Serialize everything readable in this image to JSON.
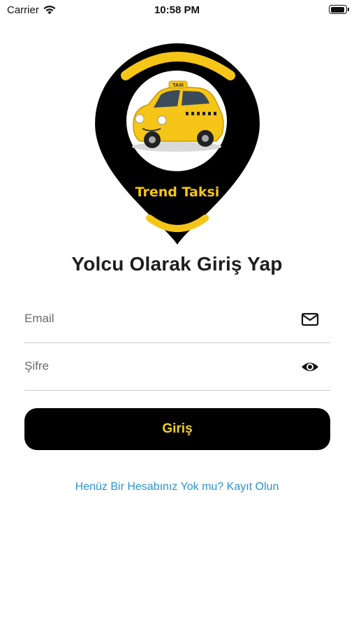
{
  "status_bar": {
    "carrier": "Carrier",
    "time": "10:58 PM"
  },
  "logo": {
    "brand_text": "Trend Taksi",
    "sign_text": "TAXI",
    "accent_color": "#f5c518"
  },
  "page": {
    "title": "Yolcu Olarak Giriş Yap"
  },
  "form": {
    "email_placeholder": "Email",
    "password_placeholder": "Şifre",
    "submit_label": "Giriş"
  },
  "footer": {
    "register_link": "Henüz Bir Hesabınız Yok mu? Kayıt Olun"
  },
  "colors": {
    "accent": "#f5d21b",
    "link": "#2b93d6",
    "button_bg": "#000000"
  }
}
